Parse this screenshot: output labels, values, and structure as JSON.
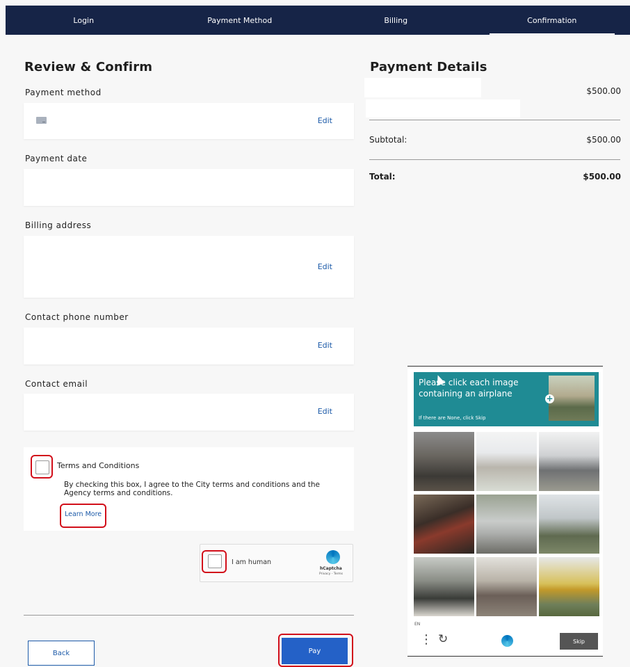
{
  "nav": {
    "steps": [
      "Login",
      "Payment Method",
      "Billing",
      "Confirmation"
    ],
    "active_index": 3
  },
  "review": {
    "title": "Review & Confirm",
    "payment_method_label": "Payment method",
    "payment_date_label": "Payment date",
    "billing_address_label": "Billing address",
    "contact_phone_label": "Contact phone number",
    "contact_email_label": "Contact email",
    "edit_label": "Edit"
  },
  "terms": {
    "title": "Terms and Conditions",
    "body": "By checking this box, I agree to the City terms and conditions and the Agency terms and conditions.",
    "learn_more": "Learn More"
  },
  "hcaptcha_widget": {
    "label": "I am human",
    "brand": "hCaptcha",
    "links": "Privacy - Terms"
  },
  "buttons": {
    "back": "Back",
    "pay": "Pay"
  },
  "payment_details": {
    "title": "Payment Details",
    "item_amount": "$500.00",
    "subtotal_label": "Subtotal:",
    "subtotal_amount": "$500.00",
    "total_label": "Total:",
    "total_amount": "$500.00"
  },
  "captcha_challenge": {
    "prompt": "Please click each image containing an airplane",
    "sub": "If there are None, click Skip",
    "lang": "EN",
    "skip": "Skip"
  },
  "colors": {
    "nav_bg": "#162447",
    "link": "#1c5aa8",
    "pay_button": "#2461c7",
    "highlight": "#d20f1a",
    "captcha_header": "#1f8b94"
  }
}
